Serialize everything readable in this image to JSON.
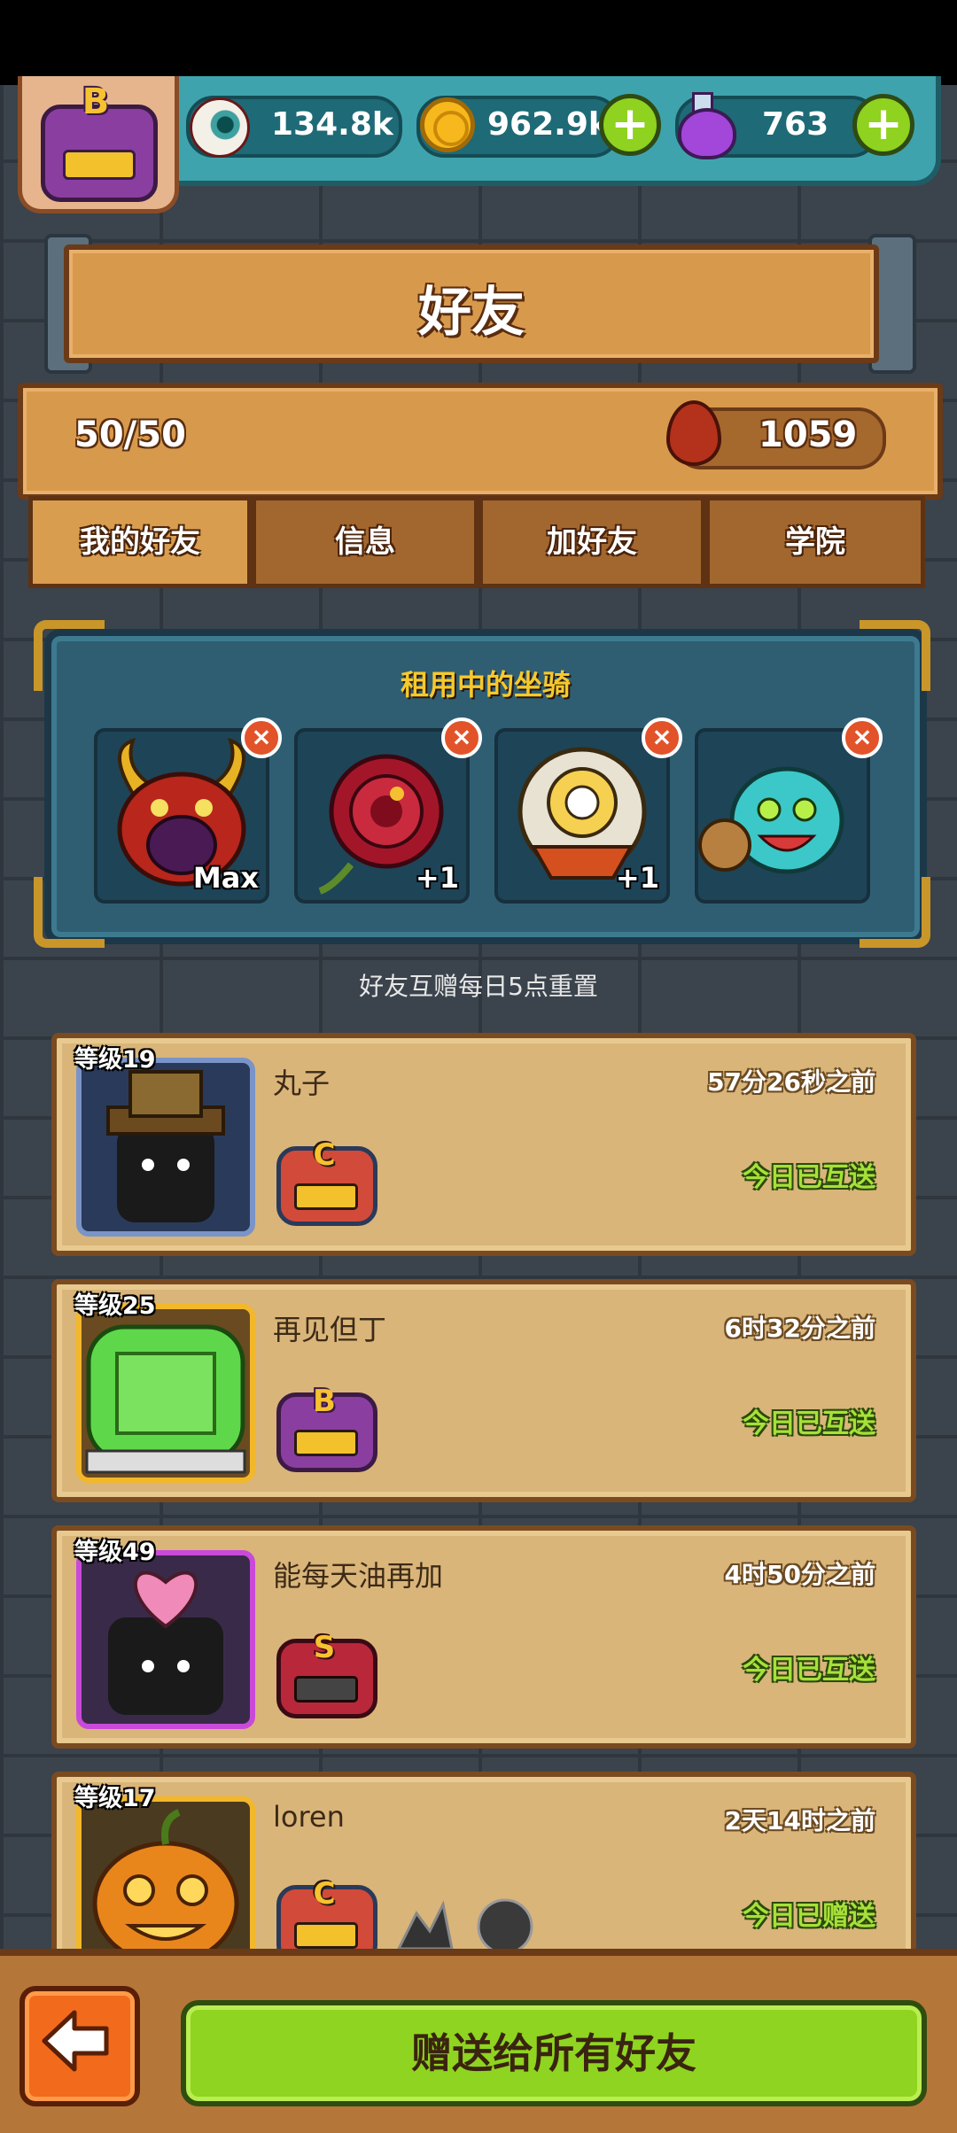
{
  "header": {
    "player_rank_letter": "B",
    "resources": [
      {
        "icon": "eyeball-icon",
        "value": "134.8k"
      },
      {
        "icon": "gold-coin-icon",
        "value": "962.9k",
        "addable": true
      },
      {
        "icon": "potion-icon",
        "value": "763",
        "addable": true
      }
    ],
    "plus_symbol": "+"
  },
  "title": "好友",
  "stats": {
    "friend_count": "50/50",
    "blood_drop_icon": "blood-drop-icon",
    "blood_value": "1059"
  },
  "tabs": [
    {
      "label": "我的好友",
      "active": true
    },
    {
      "label": "信息",
      "active": false
    },
    {
      "label": "加好友",
      "active": false
    },
    {
      "label": "学院",
      "active": false
    }
  ],
  "rented_mounts": {
    "title": "租用中的坐骑",
    "close_symbol": "×",
    "slots": [
      {
        "name": "red-horned-demon-mount",
        "tag": "Max"
      },
      {
        "name": "red-rose-mount",
        "tag": "+1"
      },
      {
        "name": "lion-dance-mount",
        "tag": "+1"
      },
      {
        "name": "teal-fish-mount",
        "tag": ""
      }
    ]
  },
  "reset_note": "好友互赠每日5点重置",
  "friends": [
    {
      "level": "等级19",
      "name": "丸子",
      "time": "57分26秒之前",
      "status": "今日已互送",
      "rank": "C"
    },
    {
      "level": "等级25",
      "name": "再见但丁",
      "time": "6时32分之前",
      "status": "今日已互送",
      "rank": "B"
    },
    {
      "level": "等级49",
      "name": "能每天油再加",
      "time": "4时50分之前",
      "status": "今日已互送",
      "rank": "S"
    },
    {
      "level": "等级17",
      "name": "loren",
      "time": "2天14时之前",
      "status": "今日已赠送",
      "rank": "C"
    }
  ],
  "footer": {
    "back_icon": "back-arrow-icon",
    "send_all_label": "赠送给所有好友"
  },
  "colors": {
    "accent_green": "#8fd420",
    "wood": "#d79a4c",
    "panel_blue": "#2f5e73",
    "gold_text": "#f5c92e"
  }
}
